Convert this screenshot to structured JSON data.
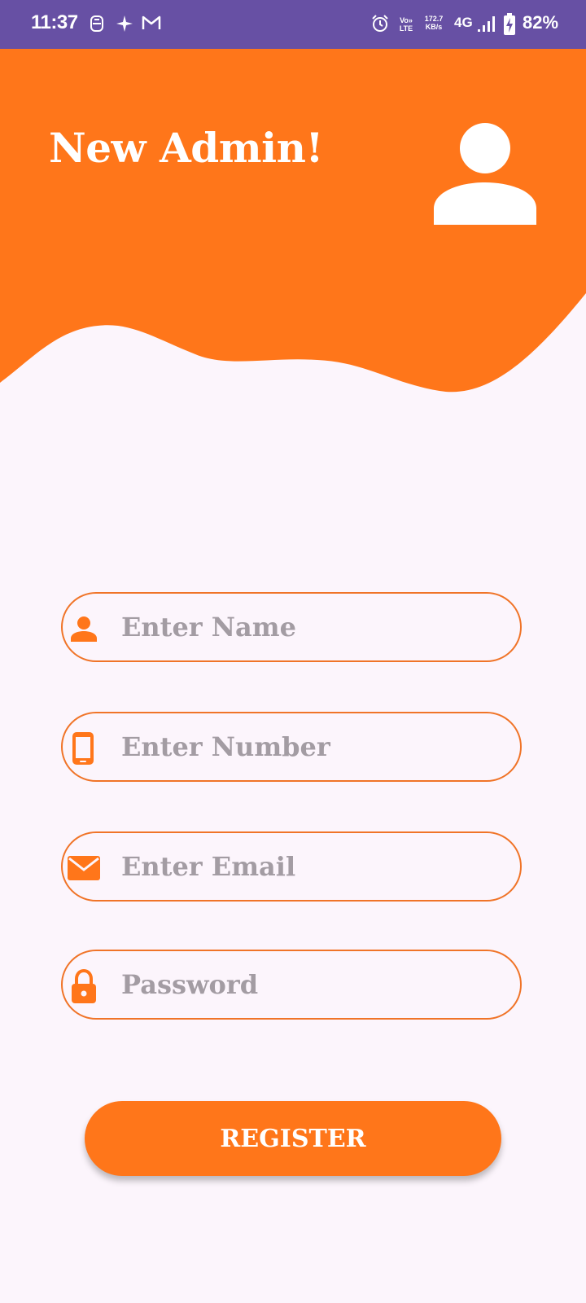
{
  "status_bar": {
    "time": "11:37",
    "volte_label": "Vo» LTE",
    "speed_value": "172.7",
    "speed_unit": "KB/s",
    "network": "4G",
    "battery": "82%"
  },
  "header": {
    "title": "New Admin!"
  },
  "form": {
    "name_placeholder": "Enter Name",
    "number_placeholder": "Enter Number",
    "email_placeholder": "Enter Email",
    "password_placeholder": "Password"
  },
  "actions": {
    "register_label": "REGISTER"
  },
  "colors": {
    "status_bar": "#6750a4",
    "brand_orange": "#ff761a",
    "background": "#fcf5fc",
    "placeholder": "#a39ca3"
  },
  "icons": {
    "status": [
      "alarm-icon",
      "volte-icon",
      "data-speed-icon",
      "signal-icon",
      "battery-charging-icon",
      "sim-icon",
      "sparkle-icon",
      "gmail-icon"
    ],
    "header": "person-icon",
    "fields": [
      "person-icon",
      "phone-icon",
      "mail-icon",
      "lock-icon"
    ]
  }
}
